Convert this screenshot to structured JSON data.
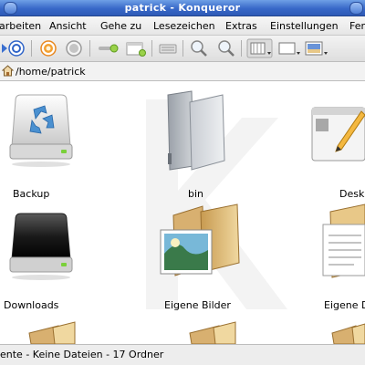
{
  "window": {
    "title": "patrick - Konqueror"
  },
  "menubar": {
    "items": [
      "Bearbeiten",
      "Ansicht",
      "Gehe zu",
      "Lesezeichen",
      "Extras",
      "Einstellungen",
      "Fenster"
    ],
    "visible": [
      "arbeiten",
      "Ansicht",
      "Gehe zu",
      "Lesezeichen",
      "Extras",
      "Einstellungen",
      "Fen"
    ]
  },
  "location": {
    "path": "/home/patrick"
  },
  "files": [
    {
      "label": "Backup",
      "icon": "hard-drive-recycle-icon"
    },
    {
      "label": "bin",
      "icon": "folder-gray-icon"
    },
    {
      "label": "Desk",
      "icon": "desktop-folder-icon"
    },
    {
      "label": "Downloads",
      "icon": "hard-drive-black-icon"
    },
    {
      "label": "Eigene Bilder",
      "icon": "folder-pictures-icon"
    },
    {
      "label": "Eigene D",
      "icon": "folder-documents-icon"
    }
  ],
  "status": {
    "text": "ente - Keine Dateien - 17 Ordner"
  },
  "colors": {
    "titlebar": "#3868c8",
    "folder": "#e8c888",
    "selection": "#2e5ab6"
  }
}
